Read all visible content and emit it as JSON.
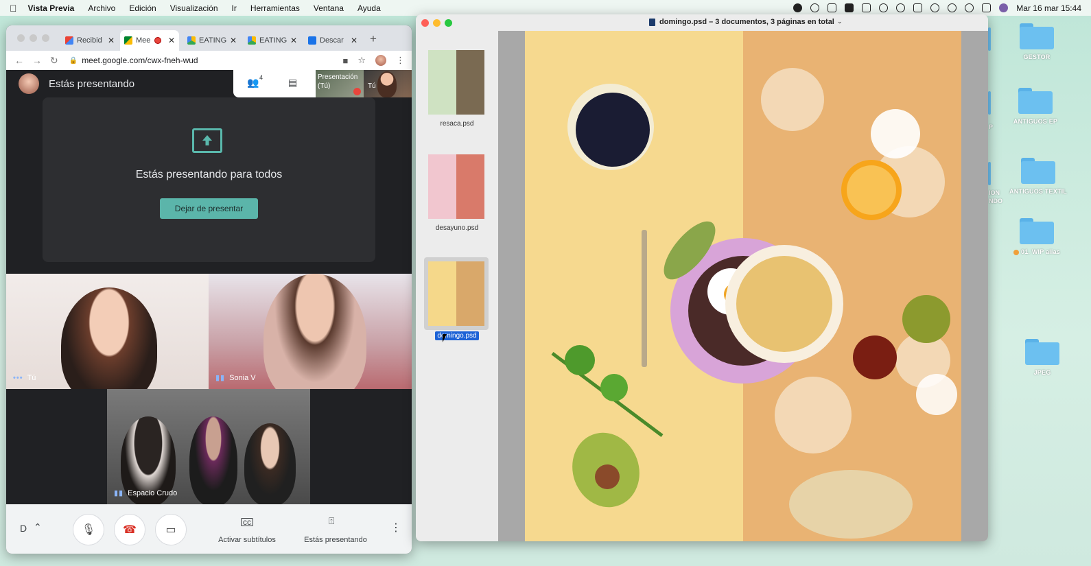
{
  "menubar": {
    "app_name": "Vista Previa",
    "items": [
      "Archivo",
      "Edición",
      "Visualización",
      "Ir",
      "Herramientas",
      "Ventana",
      "Ayuda"
    ],
    "clock": "Mar 16 mar  15:44"
  },
  "desktop": {
    "folders": [
      {
        "label": "GESTOR"
      },
      {
        "label": "ANTIGUOS EP"
      },
      {
        "label": "ANTIGUOS TEXTIL"
      },
      {
        "label": "01. WIP alias"
      },
      {
        "label": "JPEG"
      }
    ],
    "partial_labels": [
      "P",
      "ION",
      "NDO"
    ]
  },
  "chrome": {
    "tabs": [
      {
        "label": "Recibid",
        "favicon": "gmail-icon"
      },
      {
        "label": "Mee",
        "favicon": "meet-icon",
        "active": true
      },
      {
        "label": "EATING",
        "favicon": "drive-icon"
      },
      {
        "label": "EATING",
        "favicon": "drive-icon"
      },
      {
        "label": "Descar",
        "favicon": "download-icon"
      }
    ],
    "new_tab": "+",
    "url": "meet.google.com/cwx-fneh-wud"
  },
  "meet": {
    "header_title": "Estás presentando",
    "participants_count": "4",
    "self_preview": {
      "presentation_label": "Presentación",
      "presentation_sub": "(Tú)",
      "self_label": "Tú"
    },
    "presenting_message": "Estás presentando para todos",
    "stop_button": "Dejar de presentar",
    "tiles": [
      {
        "name": "Tú"
      },
      {
        "name": "Sonia V"
      },
      {
        "name": "Espacio Crudo"
      }
    ],
    "controls": {
      "meeting_initial": "D",
      "captions_label": "Activar subtítulos",
      "presenting_label": "Estás presentando"
    }
  },
  "preview": {
    "title": "domingo.psd – 3 documentos, 3 páginas en total",
    "thumbnails": [
      {
        "label": "resaca.psd"
      },
      {
        "label": "desayuno.psd"
      },
      {
        "label": "domingo.psd",
        "selected": true
      }
    ]
  },
  "colors": {
    "meet_accent": "#5bb5aa",
    "selection": "#1d63d6",
    "end_call": "#d93025"
  }
}
